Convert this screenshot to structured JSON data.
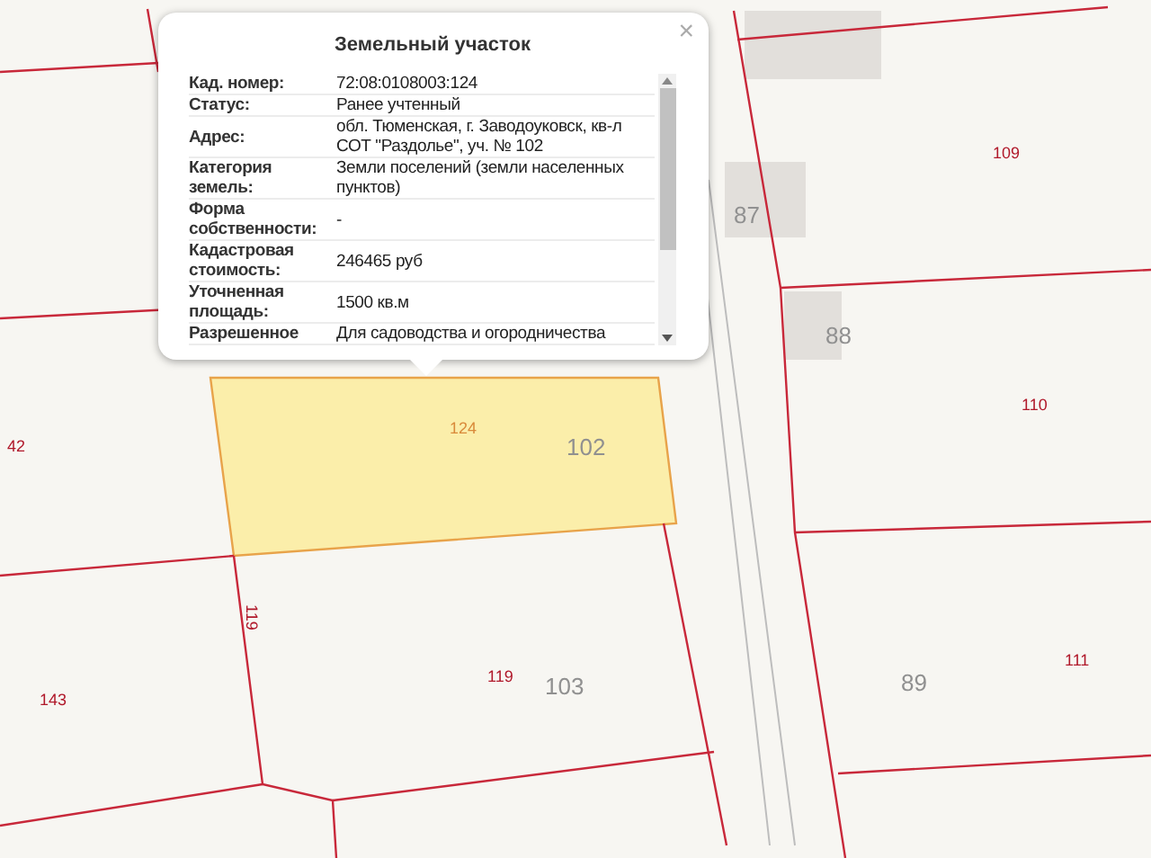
{
  "popup": {
    "title": "Земельный участок",
    "close": "×",
    "rows": [
      {
        "label": "Кад. номер:",
        "value": "72:08:0108003:124"
      },
      {
        "label": "Статус:",
        "value": "Ранее учтенный"
      },
      {
        "label": "Адрес:",
        "value": "обл. Тюменская, г. Заводоуковск, кв-л СОТ \"Раздолье\", уч. № 102"
      },
      {
        "label": "Категория земель:",
        "value": "Земли поселений (земли населенных пунктов)"
      },
      {
        "label": "Форма собственности:",
        "value": "-"
      },
      {
        "label": "Кадастровая стоимость:",
        "value": "246465 руб"
      },
      {
        "label": "Уточненная площадь:",
        "value": "1500 кв.м"
      },
      {
        "label": "Разрешенное",
        "value": "Для садоводства и огородничества"
      }
    ]
  },
  "map_labels": [
    {
      "kind": "selected",
      "text": "124"
    },
    {
      "kind": "plot",
      "text": "102"
    },
    {
      "kind": "parcel",
      "text": "109"
    },
    {
      "kind": "building",
      "text": "87"
    },
    {
      "kind": "building",
      "text": "88"
    },
    {
      "kind": "parcel",
      "text": "110"
    },
    {
      "kind": "parcel",
      "text": "42"
    },
    {
      "kind": "parcel",
      "text": "119"
    },
    {
      "kind": "parcel",
      "text": "119"
    },
    {
      "kind": "plot",
      "text": "103"
    },
    {
      "kind": "plot",
      "text": "89"
    },
    {
      "kind": "parcel",
      "text": "111"
    },
    {
      "kind": "parcel",
      "text": "143"
    }
  ]
}
